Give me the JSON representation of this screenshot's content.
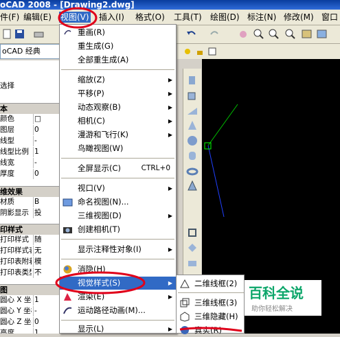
{
  "window": {
    "title": "oCAD 2008 - [Drawing2.dwg]"
  },
  "menubar": {
    "items": [
      "件(F)",
      "编辑(E)",
      "视图(V)",
      "插入(I)",
      "格式(O)",
      "工具(T)",
      "绘图(D)",
      "标注(N)",
      "修改(M)",
      "窗口"
    ],
    "selected": "视图(V)"
  },
  "workspace": {
    "value": "oCAD 经典"
  },
  "properties": {
    "select_label": "选择",
    "sections": {
      "basic": "本",
      "plot": "印样式",
      "effects": "维效果",
      "geometry": "图"
    },
    "rows": [
      {
        "k": "颜色",
        "v": "□"
      },
      {
        "k": "图层",
        "v": "0"
      },
      {
        "k": "线型",
        "v": "-"
      },
      {
        "k": "线型比例",
        "v": "1"
      },
      {
        "k": "线宽",
        "v": "-"
      },
      {
        "k": "厚度",
        "v": "0"
      },
      {
        "k": "材质",
        "v": "B"
      },
      {
        "k": "阴影显示",
        "v": "投"
      },
      {
        "k": "打印样式",
        "v": "随"
      },
      {
        "k": "打印样式表",
        "v": "无"
      },
      {
        "k": "打印表附着到",
        "v": "模"
      },
      {
        "k": "打印表类型",
        "v": "不"
      },
      {
        "k": "圆心 X 坐标",
        "v": "1"
      },
      {
        "k": "圆心 Y 坐标",
        "v": "-"
      },
      {
        "k": "圆心 Z 坐标",
        "v": "0"
      },
      {
        "k": "高度",
        "v": "1"
      }
    ]
  },
  "view_menu": {
    "items": [
      {
        "label": "重画(R)",
        "submenu": false
      },
      {
        "label": "重生成(G)",
        "submenu": false
      },
      {
        "label": "全部重生成(A)",
        "submenu": false
      },
      {
        "label": "缩放(Z)",
        "submenu": true
      },
      {
        "label": "平移(P)",
        "submenu": true
      },
      {
        "label": "动态观察(B)",
        "submenu": true
      },
      {
        "label": "相机(C)",
        "submenu": true
      },
      {
        "label": "漫游和飞行(K)",
        "submenu": true
      },
      {
        "label": "鸟瞰视图(W)",
        "submenu": false
      },
      {
        "label": "全屏显示(C)",
        "shortcut": "CTRL+0",
        "submenu": false
      },
      {
        "label": "视口(V)",
        "submenu": true
      },
      {
        "label": "命名视图(N)...",
        "submenu": false
      },
      {
        "label": "三维视图(D)",
        "submenu": true
      },
      {
        "label": "创建相机(T)",
        "submenu": false
      },
      {
        "label": "显示注释性对象(I)",
        "submenu": true
      },
      {
        "label": "消隐(H)",
        "submenu": false
      },
      {
        "label": "视觉样式(S)",
        "submenu": true
      },
      {
        "label": "渲染(E)",
        "submenu": true
      },
      {
        "label": "运动路径动画(M)...",
        "submenu": false
      },
      {
        "label": "显示(L)",
        "submenu": true
      }
    ],
    "selected": "视觉样式(S)"
  },
  "visual_styles_submenu": {
    "items": [
      "二维线框(2)",
      "三维线框(3)",
      "三维隐藏(H)",
      "真实(R)"
    ]
  },
  "watermark": {
    "brand": "百科全说",
    "tagline": "助你轻松解决"
  },
  "colors": {
    "accent": "#316ac5",
    "highlight_circle": "#e0001a",
    "canvas": "#000000"
  }
}
